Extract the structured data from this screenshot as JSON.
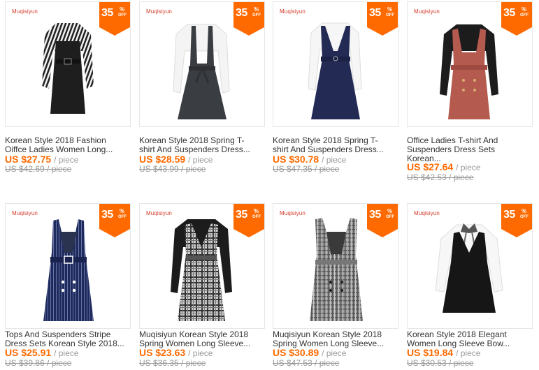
{
  "colors": {
    "badge": "#ff6a00",
    "price": "#ff6a00",
    "brand": "#d43a2a",
    "muted": "#999999"
  },
  "products": [
    {
      "brand": "Muqisiyun",
      "discount": "35",
      "pct": "%",
      "off": "OFF",
      "title_line1": "Korean Style 2018 Fashion",
      "title_line2": "Oiffce Ladies Women Long...",
      "title_line3": "",
      "price": "US $27.75",
      "unit": "/ piece",
      "old_price": "US $42.69 / piece",
      "icon": "striped-dress-image"
    },
    {
      "brand": "Muqisiyun",
      "discount": "35",
      "pct": "%",
      "off": "OFF",
      "title_line1": "Korean Style 2018 Spring T-",
      "title_line2": "shirt And Suspenders Dress...",
      "title_line3": "",
      "price": "US $28.59",
      "unit": "/ piece",
      "old_price": "US $43.99 / piece",
      "icon": "gray-suspender-dress-image"
    },
    {
      "brand": "Muqisiyun",
      "discount": "35",
      "pct": "%",
      "off": "OFF",
      "title_line1": "Korean Style 2018 Spring T-",
      "title_line2": "shirt And Suspenders Dress...",
      "title_line3": "",
      "price": "US $30.78",
      "unit": "/ piece",
      "old_price": "US $47.35 / piece",
      "icon": "navy-suspender-dress-image"
    },
    {
      "brand": "Muqisiyun",
      "discount": "35",
      "pct": "%",
      "off": "OFF",
      "title_line1": "Office Ladies T-shirt And",
      "title_line2": "Suspenders Dress Sets",
      "title_line3": "Korean...",
      "price": "US $27.64",
      "unit": "/ piece",
      "old_price": "US $42.53 / piece",
      "icon": "red-suspender-dress-image"
    },
    {
      "brand": "Muqisiyun",
      "discount": "35",
      "pct": "%",
      "off": "OFF",
      "title_line1": "Tops And Suspenders Stripe",
      "title_line2": "Dress Sets Korean Style 2018...",
      "title_line3": "",
      "price": "US $25.91",
      "unit": "/ piece",
      "old_price": "US $39.86 / piece",
      "icon": "pinstripe-dress-image"
    },
    {
      "brand": "Muqisiyun",
      "discount": "35",
      "pct": "%",
      "off": "OFF",
      "title_line1": "Muqisiyun Korean Style 2018",
      "title_line2": "Spring Women Long Sleeve...",
      "title_line3": "",
      "price": "US $23.63",
      "unit": "/ piece",
      "old_price": "US $36.35 / piece",
      "icon": "plaid-dress-image"
    },
    {
      "brand": "Muqisiyun",
      "discount": "35",
      "pct": "%",
      "off": "OFF",
      "title_line1": "Muqisiyun Korean Style 2018",
      "title_line2": "Spring Women Long Sleeve...",
      "title_line3": "",
      "price": "US $30.89",
      "unit": "/ piece",
      "old_price": "US $47.53 / piece",
      "icon": "gray-plaid-dress-image"
    },
    {
      "brand": "Muqisiyun",
      "discount": "35",
      "pct": "%",
      "off": "OFF",
      "title_line1": "Korean Style 2018 Elegant",
      "title_line2": "Women Long Sleeve Bow...",
      "title_line3": "",
      "price": "US $19.84",
      "unit": "/ piece",
      "old_price": "US $30.53 / piece",
      "icon": "black-bow-dress-image"
    }
  ]
}
